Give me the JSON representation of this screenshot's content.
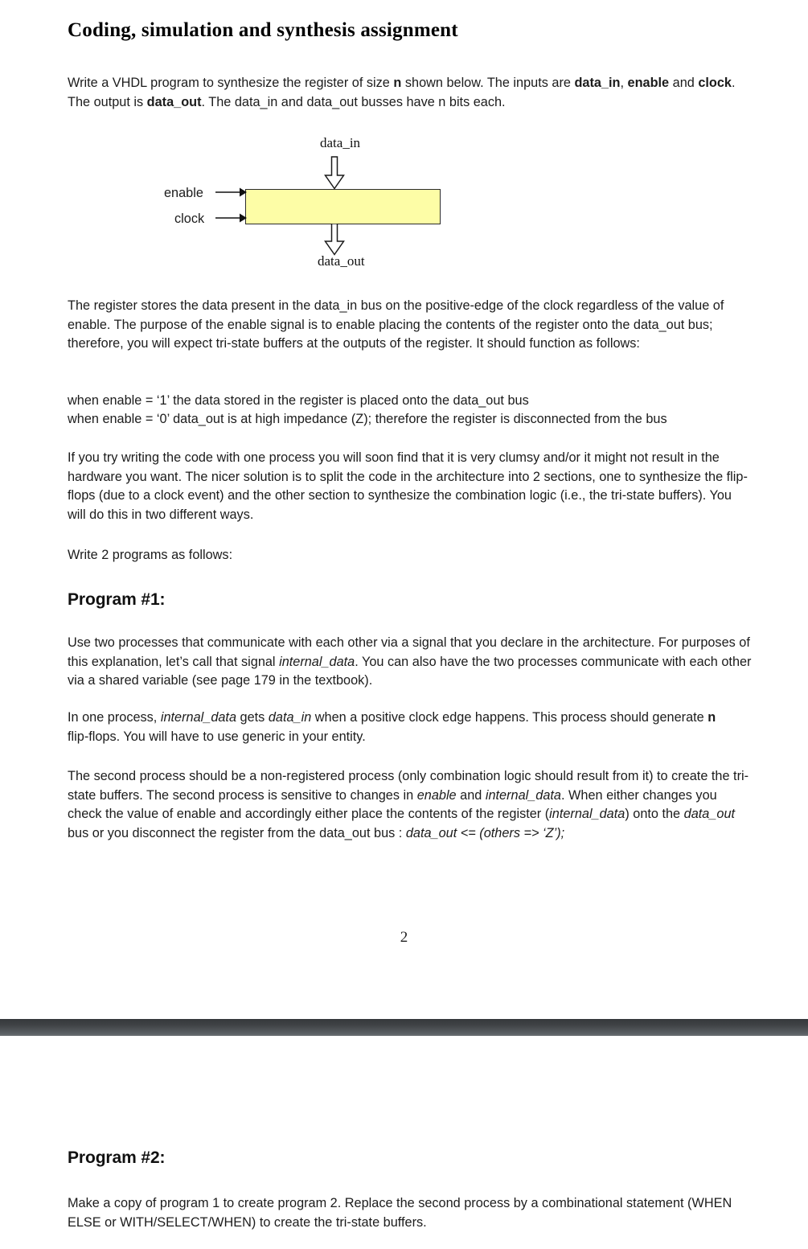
{
  "document": {
    "title": "Coding, simulation and synthesis assignment",
    "page_number": "2"
  },
  "intro": {
    "line1_a": "Write a VHDL program to synthesize the register of size ",
    "line1_n": "n",
    "line1_b": " shown below.  The inputs are ",
    "line1_datain": "data_in",
    "line1_c": ", ",
    "line1_enable": "enable",
    "line1_d": " and ",
    "line1_clock": "clock",
    "line1_e": ".  The output is ",
    "line1_dataout": "data_out",
    "line1_f": ".   The data_in and data_out busses have n bits each."
  },
  "diagram": {
    "label_data_in": "data_in",
    "label_data_out": "data_out",
    "label_enable": "enable",
    "label_clock": "clock",
    "box_fill": "#FDFDA6",
    "box_stroke": "#2B2B2B"
  },
  "paragraphs": {
    "register_behavior": "The register stores the data present in the data_in bus on the positive-edge of the clock regardless of the value of enable.  The purpose of the enable signal is to enable placing the contents of the register onto the data_out bus; therefore, you will expect tri-state buffers at the outputs of the register.  It should function as follows:",
    "when_enable_1": "when enable = ‘1’ the data stored in the register is placed onto the data_out bus",
    "when_enable_0": "when enable = ‘0’ data_out is at high impedance (Z); therefore the register is disconnected from the bus",
    "two_sections": "If you try writing the code with one process you will soon find that it is very clumsy and/or it might not result in the hardware you want.   The nicer solution is to split the code in the architecture into 2 sections, one to synthesize the flip-flops (due to a clock event) and the other section to synthesize the combination logic (i.e., the tri-state buffers).  You will do this in two different ways.",
    "write_two": "Write 2 programs as follows:"
  },
  "program1": {
    "heading": "Program #1:",
    "par1_a": "Use two processes that communicate with each other via a signal that you declare in the architecture.  For purposes of this explanation, let’s call that signal ",
    "par1_internal": "internal_data",
    "par1_b": ".   You can also have the two processes communicate with each other via a shared variable (see page 179 in the textbook).",
    "par2_a": "In one process, ",
    "par2_internal": "internal_data",
    "par2_b": " gets ",
    "par2_datain": "data_in",
    "par2_c": " when a positive clock edge happens.   This process should generate ",
    "par2_n": "n",
    "par2_d": " flip-flops.  You will have to use generic in your entity.",
    "par3_a": "The second process should be a non-registered process (only combination logic should result from it) to create the tri-state buffers.  The second process is sensitive to changes in ",
    "par3_enable": "enable",
    "par3_b": " and ",
    "par3_internal": "internal_data",
    "par3_c": ".  When either changes you check the value of enable and accordingly either place the contents of the register (",
    "par3_internal2": "internal_data",
    "par3_d": ") onto the ",
    "par3_dataout": "data_out",
    "par3_e": " bus or you disconnect the register from the data_out bus :  ",
    "par3_code": "data_out <= (others => ‘Z’);"
  },
  "program2": {
    "heading": "Program #2:",
    "par1": "Make a copy of program 1 to create program 2.  Replace the second process by a combinational statement (WHEN ELSE or WITH/SELECT/WHEN) to create the tri-state buffers."
  },
  "separator": {
    "color_top": "#35383b",
    "color_bottom": "#5e6367"
  }
}
